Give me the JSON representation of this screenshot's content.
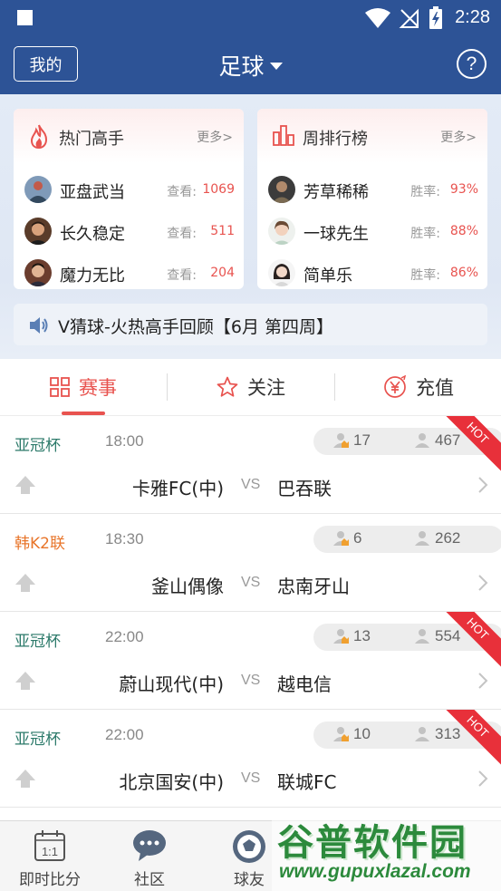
{
  "status_bar": {
    "time": "2:28"
  },
  "header": {
    "mine_label": "我的",
    "title": "足球",
    "help_label": "?"
  },
  "hot_experts": {
    "title": "热门高手",
    "more": "更多>",
    "items": [
      {
        "name": "亚盘武当",
        "label": "查看:",
        "value": "1069"
      },
      {
        "name": "长久稳定",
        "label": "查看:",
        "value": "511"
      },
      {
        "name": "魔力无比",
        "label": "查看:",
        "value": "204"
      }
    ]
  },
  "weekly_rank": {
    "title": "周排行榜",
    "more": "更多>",
    "items": [
      {
        "name": "芳草稀稀",
        "label": "胜率:",
        "value": "93%"
      },
      {
        "name": "一球先生",
        "label": "胜率:",
        "value": "88%"
      },
      {
        "name": "简单乐",
        "label": "胜率:",
        "value": "86%"
      }
    ]
  },
  "notice": {
    "text": "V猜球-火热高手回顾【6月 第四周】"
  },
  "tabs": [
    {
      "label": "赛事",
      "icon": "grid-icon",
      "active": true
    },
    {
      "label": "关注",
      "icon": "star-icon",
      "active": false
    },
    {
      "label": "充值",
      "icon": "yen-coin-icon",
      "active": false
    }
  ],
  "colors": {
    "primary": "#2d5396",
    "accent": "#e8534f",
    "league_green": "#2c7a6a",
    "league_orange": "#e8752a",
    "hot": "#e8303a"
  },
  "matches": [
    {
      "league": "亚冠杯",
      "league_color": "#2c7a6a",
      "time": "18:00",
      "stat1": "17",
      "stat2": "467",
      "home": "卡雅FC(中)",
      "vs": "VS",
      "away": "巴吞联",
      "hot": "HOT"
    },
    {
      "league": "韩K2联",
      "league_color": "#e8752a",
      "time": "18:30",
      "stat1": "6",
      "stat2": "262",
      "home": "釜山偶像",
      "vs": "VS",
      "away": "忠南牙山",
      "hot": ""
    },
    {
      "league": "亚冠杯",
      "league_color": "#2c7a6a",
      "time": "22:00",
      "stat1": "13",
      "stat2": "554",
      "home": "蔚山现代(中)",
      "vs": "VS",
      "away": "越电信",
      "hot": "HOT"
    },
    {
      "league": "亚冠杯",
      "league_color": "#2c7a6a",
      "time": "22:00",
      "stat1": "10",
      "stat2": "313",
      "home": "北京国安(中)",
      "vs": "VS",
      "away": "联城FC",
      "hot": "HOT"
    }
  ],
  "bottom_nav": [
    {
      "label": "即时比分",
      "icon": "scoreboard-icon"
    },
    {
      "label": "社区",
      "icon": "chat-bubble-icon"
    },
    {
      "label": "球友",
      "icon": "football-icon"
    }
  ],
  "watermark": {
    "main": "谷普软件园",
    "url": "www.gupuxlazal.com"
  }
}
